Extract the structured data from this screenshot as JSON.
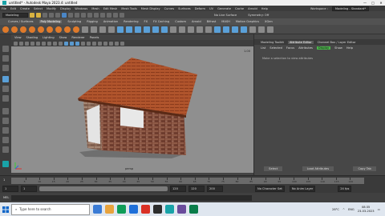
{
  "window": {
    "title": "untitled* - Autodesk Maya 2023.4: untitled",
    "controls": [
      "—",
      "□",
      "✕"
    ]
  },
  "menubar": {
    "items": [
      "File",
      "Edit",
      "Create",
      "Select",
      "Modify",
      "Display",
      "Windows",
      "Mesh",
      "Edit Mesh",
      "Mesh Tools",
      "Mesh Display",
      "Curves",
      "Surfaces",
      "Deform",
      "UV",
      "Generate",
      "Cache",
      "Arnold",
      "Help"
    ],
    "workspace_label": "Workspace :",
    "workspace_value": "Modeling - Standard*"
  },
  "statusline": {
    "mode": "Modeling",
    "live_surface": "No Live Surface",
    "symmetry": "Symmetry: Off"
  },
  "shelf": {
    "tabs": [
      "Curves / Surfaces",
      "Poly Modeling",
      "Sculpting",
      "Rigging",
      "Animation",
      "Rendering",
      "FX",
      "FX Caching",
      "Custom",
      "Arnold",
      "Bifrost",
      "MASH",
      "Motion Graphics",
      "XGen"
    ],
    "active_tab": "Poly Modeling"
  },
  "viewport": {
    "menu": [
      "View",
      "Shading",
      "Lighting",
      "Show",
      "Renderer",
      "Panels"
    ],
    "camera_label": "persp",
    "scale_label": "1.00"
  },
  "attribute_editor": {
    "tabs": [
      "Modeling Toolkit",
      "Attribute Editor",
      "Channel Box / Layer Editor"
    ],
    "active_tab": "Attribute Editor",
    "menu": [
      "List",
      "Selected",
      "Focus",
      "Attributes",
      "Display",
      "Show",
      "Help"
    ],
    "focus_label": "Display",
    "message": "Make a selection to view attributes",
    "buttons": [
      "Select",
      "Load Attributes",
      "Copy Tab"
    ]
  },
  "timeslider": {
    "current_frame": "1",
    "ticks": [
      "5",
      "10",
      "15",
      "20",
      "25",
      "30",
      "35",
      "40",
      "45",
      "50",
      "55",
      "60",
      "65",
      "70",
      "75",
      "80",
      "85",
      "90",
      "95",
      "100",
      "105",
      "110",
      "115",
      "120"
    ]
  },
  "range": {
    "start": "1",
    "range_start": "1",
    "range_end": "120",
    "end": "120",
    "anim_end": "200",
    "fps": "24 fps",
    "character_set": "No Character Set",
    "anim_layer": "No Anim Layer"
  },
  "melbar": {
    "label": "MEL"
  },
  "taskbar": {
    "search_placeholder": "Type here to search",
    "weather": "28°C",
    "language": "ENG",
    "time": "08:35",
    "date": "23-03-2023",
    "app_colors": [
      "#3a7bd5",
      "#e8a33d",
      "#0f9d58",
      "#1e6fd9",
      "#d93025",
      "#2d2d2d",
      "#19a3a8",
      "#6a4c9c",
      "#0a7d4a"
    ]
  }
}
